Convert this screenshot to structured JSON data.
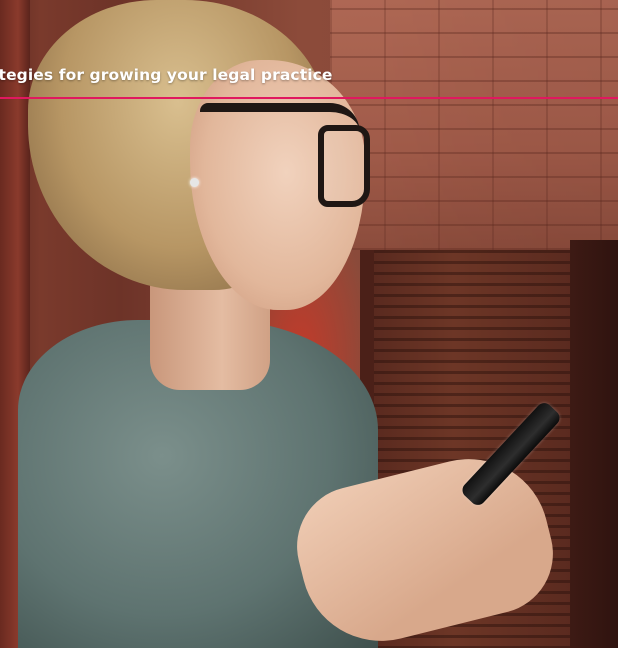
{
  "hero": {
    "headline": "ategies for growing your legal practice",
    "image_subject": "woman-with-glasses-using-smartphone",
    "accent_color": "#e0185f"
  }
}
